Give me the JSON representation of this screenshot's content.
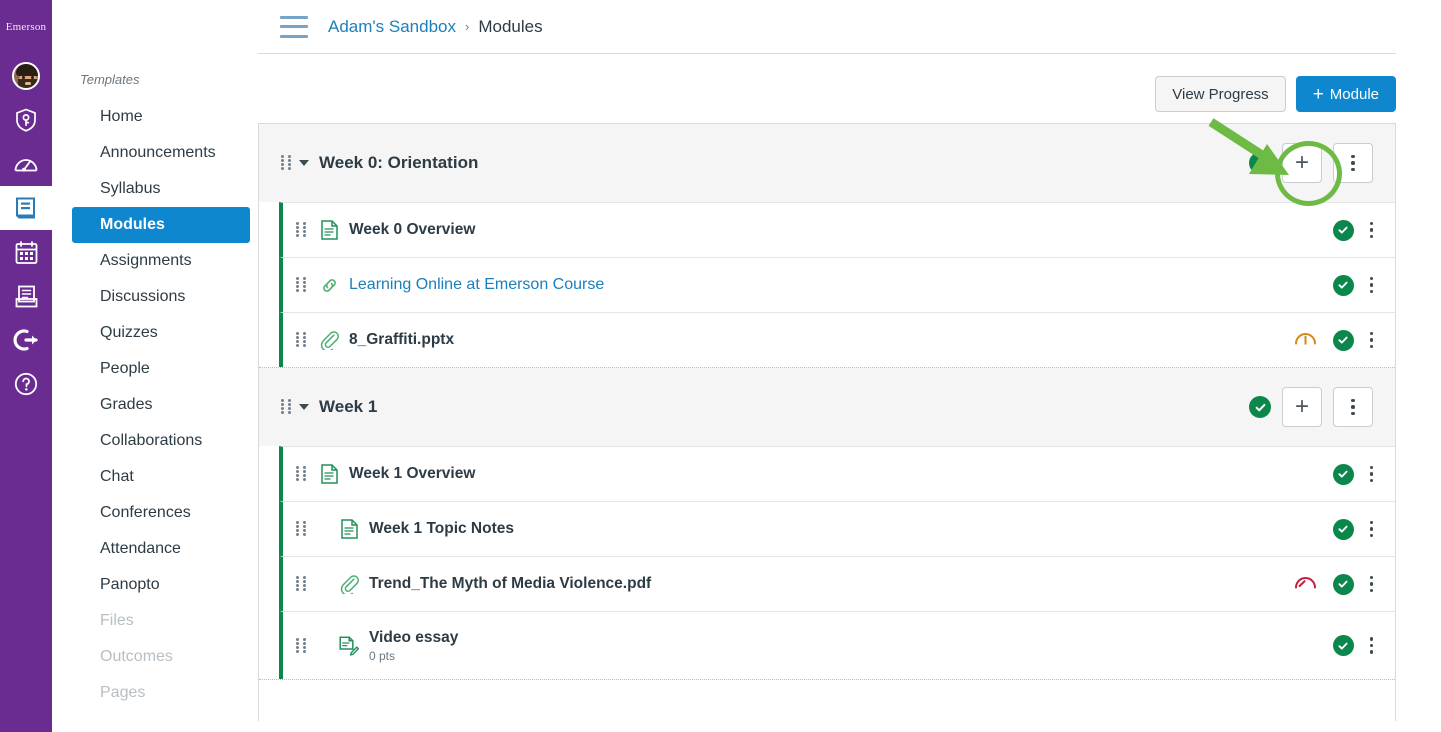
{
  "global_nav": {
    "logo_text": "Emerson",
    "items": [
      {
        "name": "account-avatar",
        "label": "Account",
        "icon": "avatar"
      },
      {
        "name": "admin",
        "label": "Admin",
        "icon": "shield-key-icon"
      },
      {
        "name": "dashboard",
        "label": "Dashboard",
        "icon": "gauge-icon"
      },
      {
        "name": "courses",
        "label": "Courses",
        "icon": "book-icon",
        "active": true
      },
      {
        "name": "calendar",
        "label": "Calendar",
        "icon": "calendar-icon"
      },
      {
        "name": "inbox",
        "label": "Inbox",
        "icon": "inbox-icon"
      },
      {
        "name": "logout",
        "label": "Log Out",
        "icon": "logout-arrow-icon"
      },
      {
        "name": "help",
        "label": "Help",
        "icon": "question-circle-icon"
      }
    ]
  },
  "course_nav": {
    "heading": "Templates",
    "items": [
      {
        "label": "Home",
        "state": "normal"
      },
      {
        "label": "Announcements",
        "state": "normal"
      },
      {
        "label": "Syllabus",
        "state": "normal"
      },
      {
        "label": "Modules",
        "state": "active"
      },
      {
        "label": "Assignments",
        "state": "normal"
      },
      {
        "label": "Discussions",
        "state": "normal"
      },
      {
        "label": "Quizzes",
        "state": "normal"
      },
      {
        "label": "People",
        "state": "normal"
      },
      {
        "label": "Grades",
        "state": "normal"
      },
      {
        "label": "Collaborations",
        "state": "normal"
      },
      {
        "label": "Chat",
        "state": "normal"
      },
      {
        "label": "Conferences",
        "state": "normal"
      },
      {
        "label": "Attendance",
        "state": "normal"
      },
      {
        "label": "Panopto",
        "state": "normal"
      },
      {
        "label": "Files",
        "state": "muted"
      },
      {
        "label": "Outcomes",
        "state": "muted"
      },
      {
        "label": "Pages",
        "state": "muted"
      }
    ]
  },
  "breadcrumb": {
    "course": "Adam's Sandbox",
    "separator": "›",
    "current": "Modules"
  },
  "toolbar": {
    "view_progress_label": "View Progress",
    "add_module_label": "Module",
    "add_module_plus": "+"
  },
  "modules": [
    {
      "title": "Week 0: Orientation",
      "published": true,
      "add_label": "+",
      "items": [
        {
          "title": "Week 0 Overview",
          "icon": "page-icon",
          "indent": 0,
          "style": "bold",
          "published": true,
          "ally": null
        },
        {
          "title": "Learning Online at Emerson Course",
          "icon": "link-icon",
          "indent": 0,
          "style": "link",
          "published": true,
          "ally": null
        },
        {
          "title": "8_Graffiti.pptx",
          "icon": "paperclip-icon",
          "indent": 0,
          "style": "bold",
          "published": true,
          "ally": "orange"
        }
      ]
    },
    {
      "title": "Week 1",
      "published": true,
      "add_label": "+",
      "items": [
        {
          "title": "Week 1 Overview",
          "icon": "page-icon",
          "indent": 0,
          "style": "bold",
          "published": true,
          "ally": null
        },
        {
          "title": "Week 1 Topic Notes",
          "icon": "page-icon",
          "indent": 1,
          "style": "bold",
          "published": true,
          "ally": null
        },
        {
          "title": "Trend_The Myth of Media Violence.pdf",
          "icon": "paperclip-icon",
          "indent": 1,
          "style": "bold",
          "published": true,
          "ally": "red"
        },
        {
          "title": "Video essay",
          "subtitle": "0 pts",
          "icon": "assignment-icon",
          "indent": 1,
          "style": "bold",
          "published": true,
          "ally": null
        }
      ]
    }
  ],
  "annotation": {
    "shape": "circle-and-arrow",
    "target": "add-item-button-week-0",
    "color": "#6dba44"
  },
  "colors": {
    "brand_purple": "#6B2C91",
    "link_blue": "#1a7fbd",
    "primary_blue": "#0f87cf",
    "published_green": "#0b874b",
    "annotation_green": "#6dba44",
    "ally_orange": "#d8861b",
    "ally_red": "#c41c3c"
  }
}
